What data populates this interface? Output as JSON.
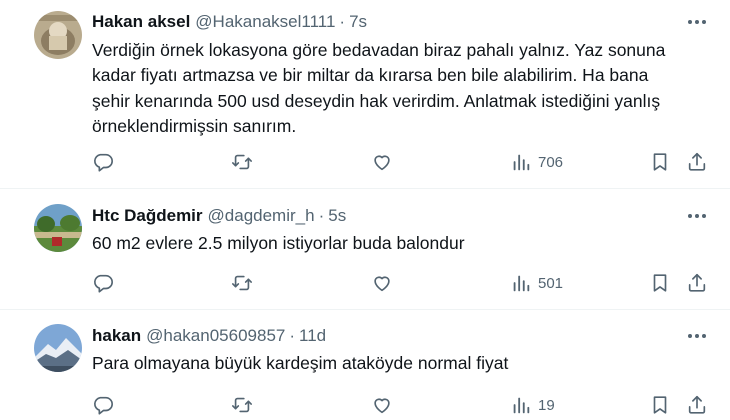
{
  "tweets": [
    {
      "name": "Hakan aksel",
      "handle": "@Hakanaksel1111",
      "separator": "·",
      "time": "7s",
      "lines": [
        "Verdiğin örnek lokasyona göre bedavadan biraz pahalı yalnız. Yaz sonuna",
        "kadar fiyatı artmazsa ve bir miltar da kırarsa ben bile alabilirim. Ha bana",
        "şehir kenarında 500 usd deseydin hak verirdim. Anlatmak istediğini yanlış",
        "örneklendirmişsin sanırım."
      ],
      "views": "706"
    },
    {
      "name": "Htc Dağdemir",
      "handle": "@dagdemir_h",
      "separator": "·",
      "time": "5s",
      "lines": [
        "60 m2 evlere 2.5 milyon istiyorlar buda balondur"
      ],
      "views": "501"
    },
    {
      "name": "hakan",
      "handle": "@hakan05609857",
      "separator": "·",
      "time": "11d",
      "lines": [
        "Para olmayana büyük kardeşim ataköyde normal fiyat"
      ],
      "views": "19"
    }
  ],
  "icons": {
    "reply": "speech-bubble-icon",
    "retweet": "retweet-arrows-icon",
    "like": "heart-icon",
    "views": "bar-chart-icon",
    "bookmark": "bookmark-icon",
    "share": "share-upload-icon",
    "more": "three-dots-icon"
  },
  "colors": {
    "text": "#0f1419",
    "secondary": "#536471",
    "divider": "#eff3f4"
  }
}
